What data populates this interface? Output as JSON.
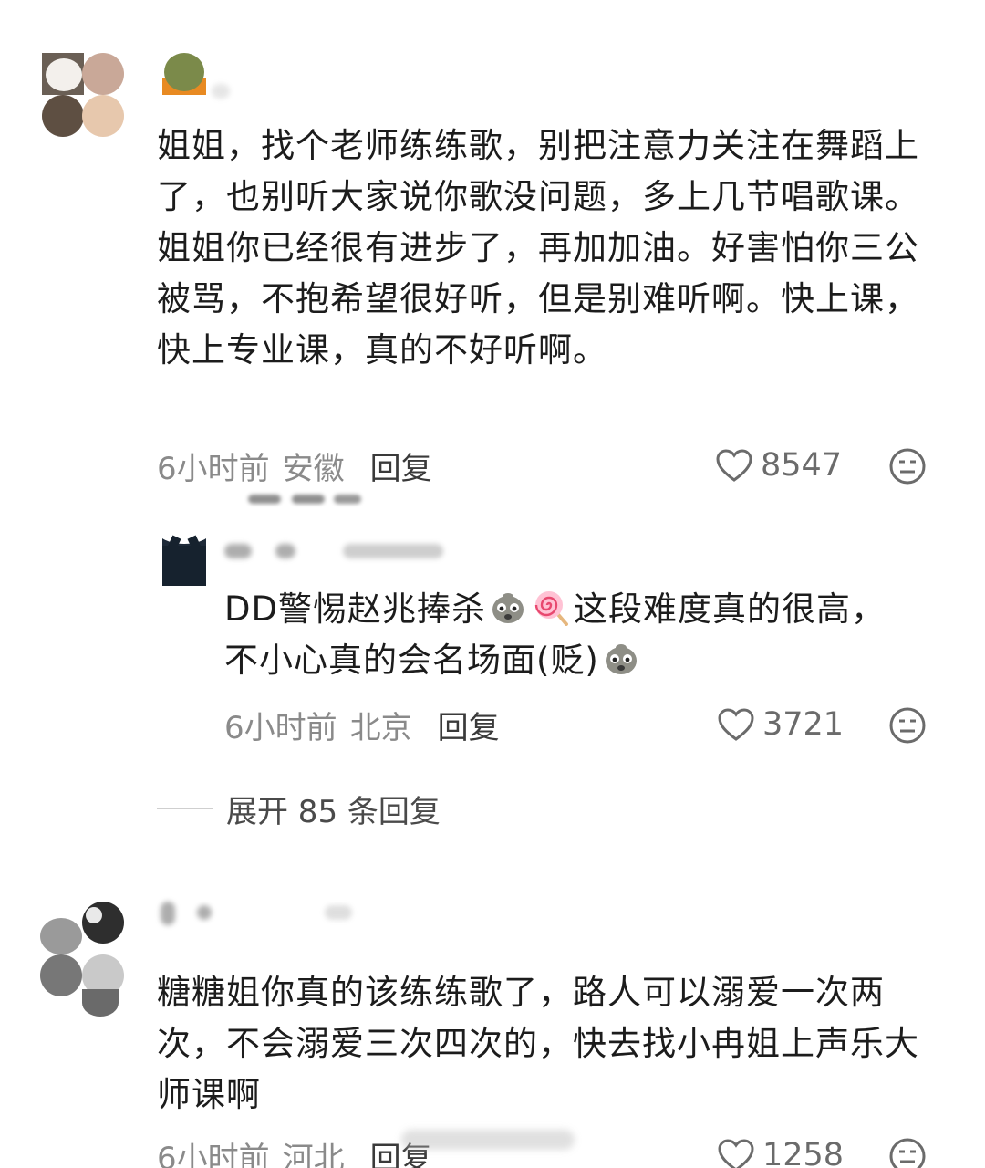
{
  "comments": [
    {
      "text": "姐姐，找个老师练练歌，别把注意力关注在舞蹈上了，也别听大家说你歌没问题，多上几节唱歌课。姐姐你已经很有进步了，再加加油。好害怕你三公被骂，不抱希望很好听，但是别难听啊。快上课，快上专业课，真的不好听啊。",
      "time": "6小时前",
      "location": "安徽",
      "reply_label": "回复",
      "likes": "8547"
    },
    {
      "text_before": "DD警惕赵兆捧杀",
      "text_after": "这段难度真的很高，不小心真的会名场面(贬)",
      "emoji_1": "face-emoji",
      "emoji_2": "lollipop-emoji",
      "emoji_3": "face-emoji",
      "time": "6小时前",
      "location": "北京",
      "reply_label": "回复",
      "likes": "3721"
    },
    {
      "text": "糖糖姐你真的该练练歌了，路人可以溺爱一次两次，不会溺爱三次四次的，快去找小冉姐上声乐大师课啊",
      "time": "6小时前",
      "location": "河北",
      "reply_label": "回复",
      "likes": "1258"
    }
  ],
  "expand_replies": "展开 85 条回复",
  "icons": {
    "like": "heart-outline-icon",
    "dislike": "meh-face-icon"
  },
  "colors": {
    "text": "#1c1c1c",
    "meta": "#8a8a8a",
    "reply": "#3a3a3a"
  }
}
